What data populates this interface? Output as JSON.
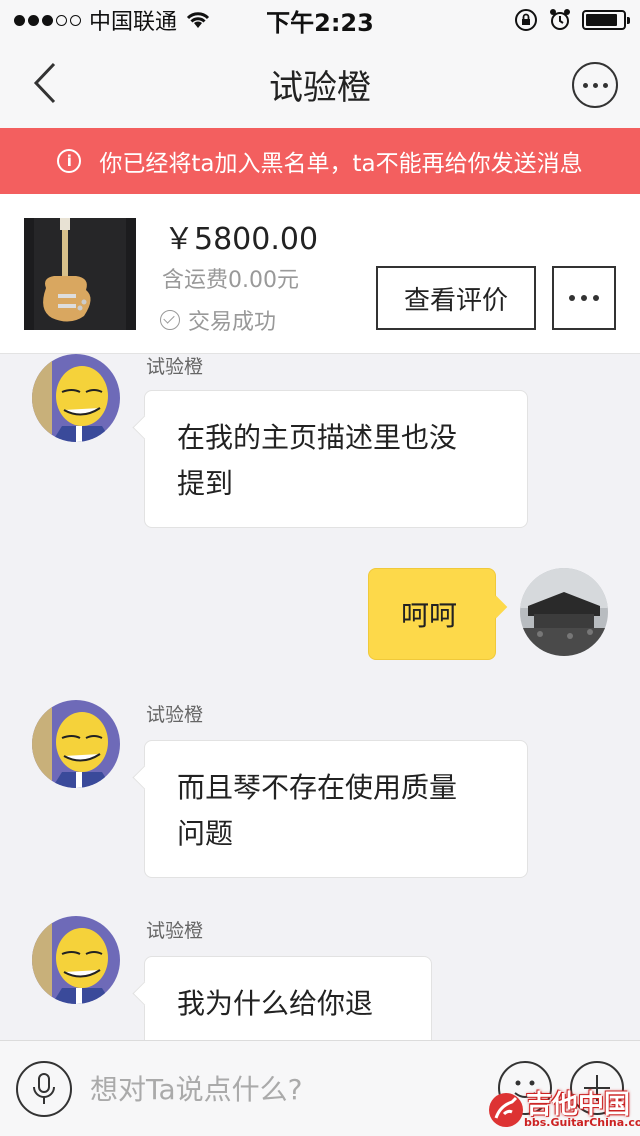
{
  "status_bar": {
    "carrier": "中国联通",
    "time": "下午2:23",
    "battery_level": 0.85
  },
  "nav": {
    "title": "试验橙"
  },
  "banner": {
    "text": "你已经将ta加入黑名单，ta不能再给你发送消息"
  },
  "product": {
    "price": "￥5800.00",
    "shipping": "含运费0.00元",
    "status": "交易成功",
    "review_button": "查看评价"
  },
  "messages": [
    {
      "direction": "in",
      "sender": "试验橙",
      "text_lines": [
        "在我的主页描述里也没",
        "提到"
      ]
    },
    {
      "direction": "out",
      "text_lines": [
        "呵呵"
      ]
    },
    {
      "direction": "in",
      "sender": "试验橙",
      "text_lines": [
        "而且琴不存在使用质量",
        "问题"
      ]
    },
    {
      "direction": "in",
      "sender": "试验橙",
      "text_lines": [
        "我为什么给你退"
      ]
    }
  ],
  "input": {
    "placeholder": "想对Ta说点什么?"
  },
  "watermark": {
    "main": "吉他中国",
    "sub": "bbs.GuitarChina.com"
  },
  "colors": {
    "banner_bg": "#f35f5f",
    "outgoing_bubble": "#fdd94a",
    "page_bg": "#f2f2f5"
  },
  "icons": [
    "back-chevron-icon",
    "more-dots-icon",
    "info-icon",
    "check-circle-icon",
    "microphone-icon",
    "emoji-icon",
    "plus-icon"
  ]
}
